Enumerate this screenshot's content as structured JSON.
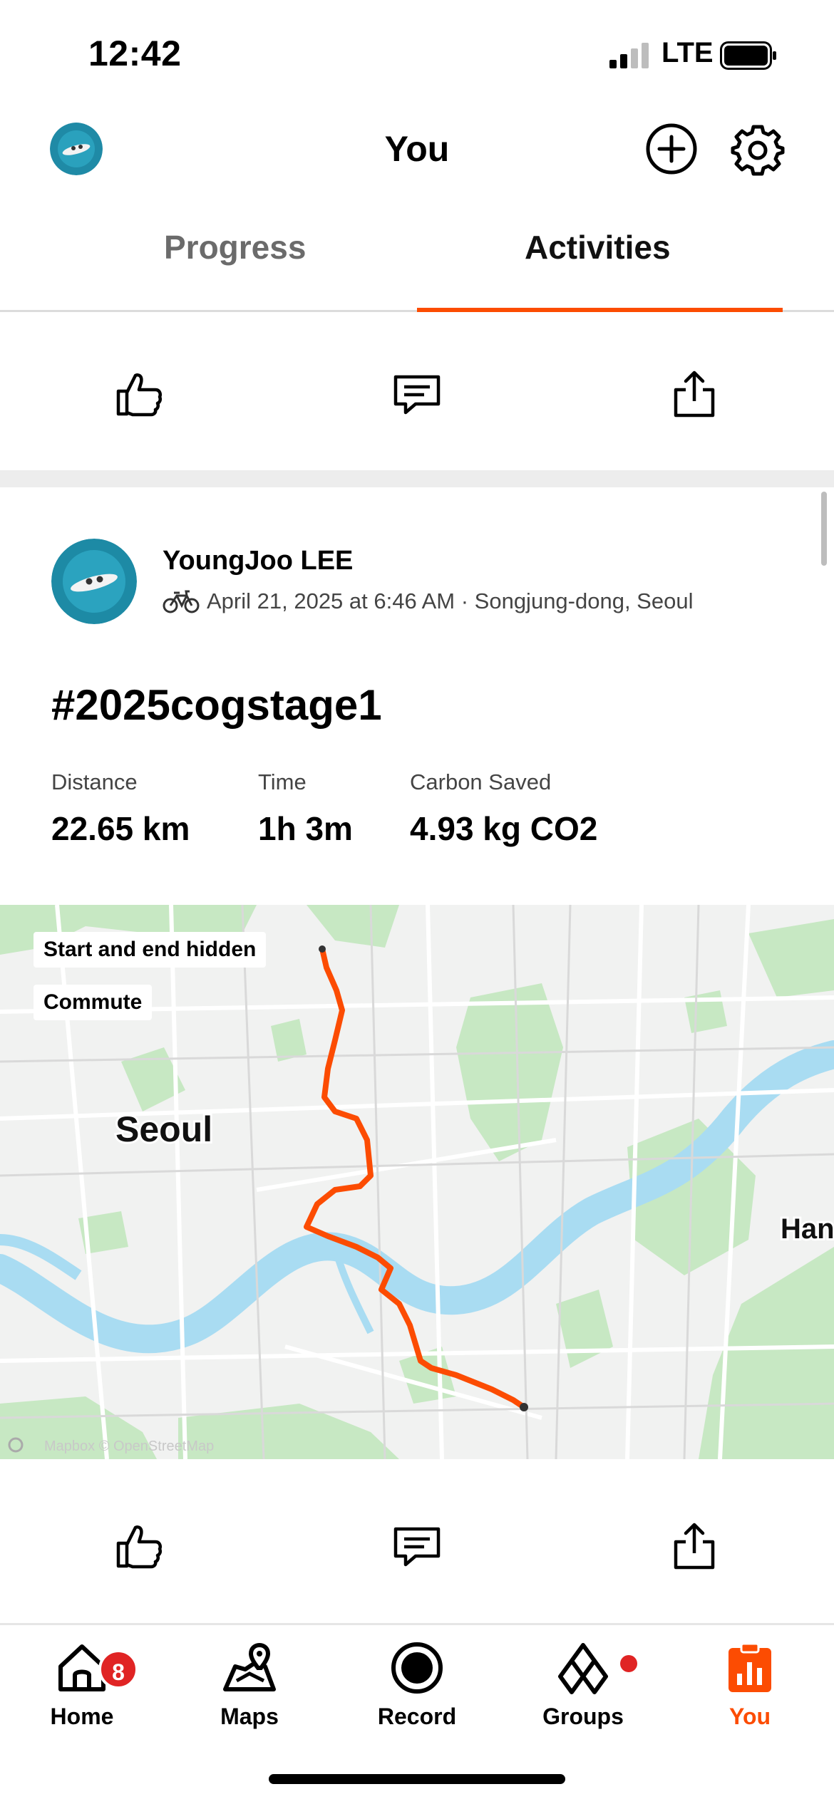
{
  "status_bar": {
    "time": "12:42",
    "network": "LTE"
  },
  "top_nav": {
    "title": "You"
  },
  "tabs": [
    {
      "label": "Progress",
      "active": false
    },
    {
      "label": "Activities",
      "active": true
    }
  ],
  "post": {
    "athlete_name": "YoungJoo LEE",
    "meta": "April 21, 2025 at 6:46 AM · Songjung-dong, Seoul",
    "title": "#2025cogstage1",
    "stats": [
      {
        "label": "Distance",
        "value": "22.65 km"
      },
      {
        "label": "Time",
        "value": "1h 3m"
      },
      {
        "label": "Carbon Saved",
        "value": "4.93 kg CO2"
      }
    ],
    "map": {
      "tags": [
        "Start and end hidden",
        "Commute"
      ],
      "city_label": "Seoul",
      "edge_label": "Han",
      "attribution": "Mapbox © OpenStreetMap",
      "route_color": "#fc4c02"
    }
  },
  "bottom_tabs": [
    {
      "label": "Home",
      "icon": "home-icon",
      "badge": "8"
    },
    {
      "label": "Maps",
      "icon": "maps-icon"
    },
    {
      "label": "Record",
      "icon": "record-icon"
    },
    {
      "label": "Groups",
      "icon": "groups-icon",
      "dot": true
    },
    {
      "label": "You",
      "icon": "you-icon",
      "active": true
    }
  ],
  "colors": {
    "accent": "#fc4c02",
    "badge": "#e02424",
    "water": "#a9dcf2",
    "park": "#c7e8c3"
  }
}
